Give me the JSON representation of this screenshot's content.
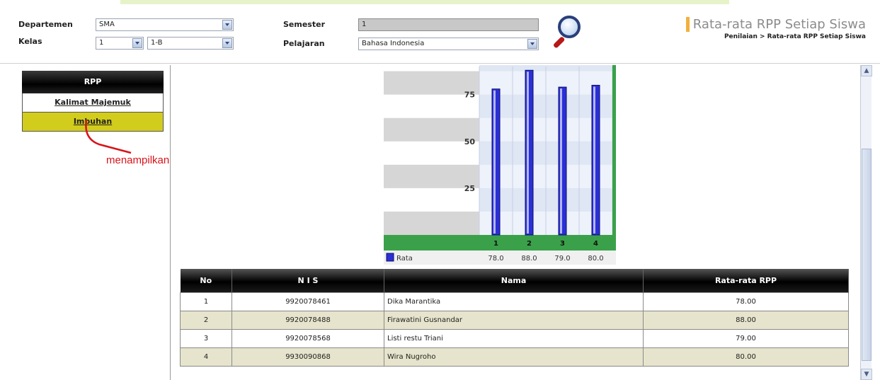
{
  "filters": {
    "departemen_label": "Departemen",
    "departemen_value": "SMA",
    "kelas_label": "Kelas",
    "kelas_value": "1",
    "kelas_sub_value": "1-B",
    "semester_label": "Semester",
    "semester_value": "1",
    "pelajaran_label": "Pelajaran",
    "pelajaran_value": "Bahasa Indonesia"
  },
  "header": {
    "title": "Rata-rata RPP Setiap Siswa",
    "breadcrumb": "Penilaian > Rata-rata RPP Setiap Siswa"
  },
  "rpp": {
    "title": "RPP",
    "items": [
      {
        "label": "Kalimat Majemuk",
        "active": false
      },
      {
        "label": "Imbuhan",
        "active": true
      }
    ],
    "annotation": "menampilkan data RPP setiap siswa"
  },
  "chart_data": {
    "type": "bar",
    "categories": [
      "1",
      "2",
      "3",
      "4"
    ],
    "series": [
      {
        "name": "Rata",
        "values": [
          78.0,
          88.0,
          79.0,
          80.0
        ]
      }
    ],
    "value_labels": [
      "78.0",
      "88.0",
      "79.0",
      "80.0"
    ],
    "yticks": [
      "25",
      "50",
      "75"
    ],
    "ylim": [
      0,
      90
    ],
    "legend": "bottom-left",
    "colors": {
      "bar": "#2b2fd6",
      "band": "#3aa14a",
      "grid_alt": "#d6d6d6"
    }
  },
  "table": {
    "headers": [
      "No",
      "N I S",
      "Nama",
      "Rata-rata RPP"
    ],
    "rows": [
      {
        "no": "1",
        "nis": "9920078461",
        "nama": "Dika Marantika",
        "rata": "78.00"
      },
      {
        "no": "2",
        "nis": "9920078488",
        "nama": "Firawatini Gusnandar",
        "rata": "88.00"
      },
      {
        "no": "3",
        "nis": "9920078568",
        "nama": "Listi restu Triani",
        "rata": "79.00"
      },
      {
        "no": "4",
        "nis": "9930090868",
        "nama": "Wira Nugroho",
        "rata": "80.00"
      }
    ]
  }
}
